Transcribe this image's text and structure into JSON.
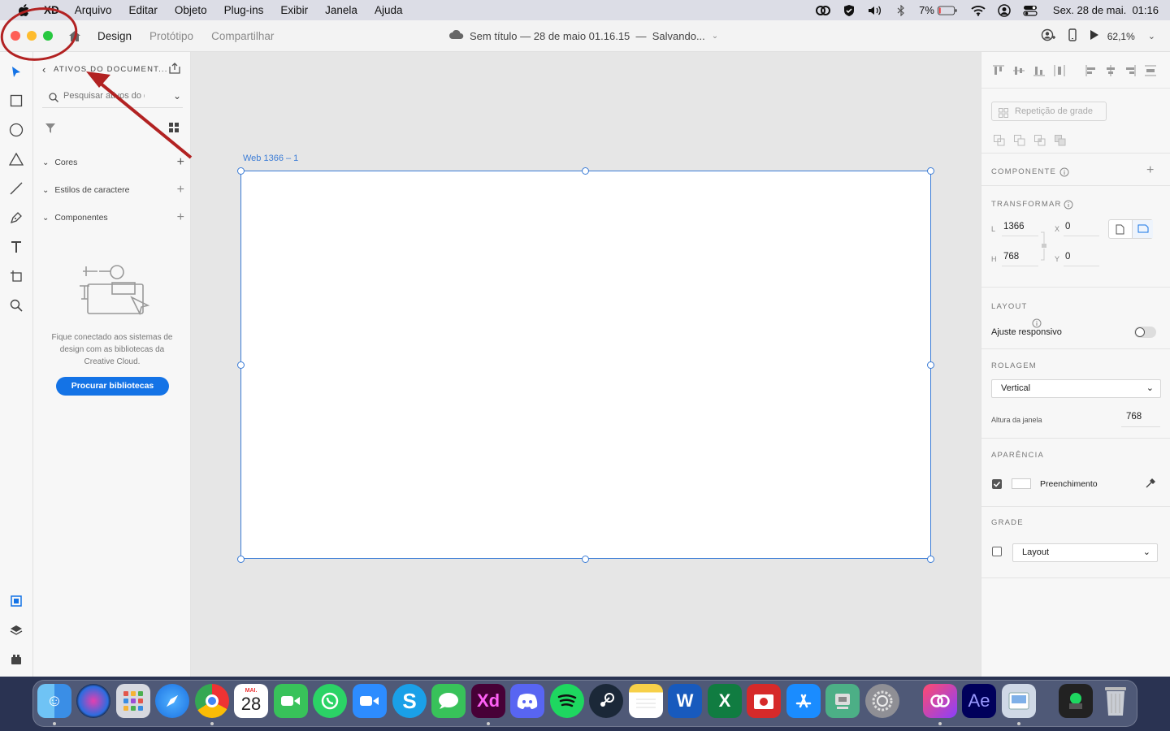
{
  "menubar": {
    "app_name": "XD",
    "items": [
      "Arquivo",
      "Editar",
      "Objeto",
      "Plug-ins",
      "Exibir",
      "Janela",
      "Ajuda"
    ],
    "battery": "7%",
    "datetime": "Sex. 28 de mai.  01:16"
  },
  "titlebar": {
    "tabs": [
      "Design",
      "Protótipo",
      "Compartilhar"
    ],
    "doc_title": "Sem título — 28 de maio 01.16.15  —  Salvando...",
    "zoom": "62,1%"
  },
  "left_panel": {
    "header": "ATIVOS DO DOCUMENT...",
    "search_placeholder": "Pesquisar ativos do documento",
    "sections": [
      "Cores",
      "Estilos de caractere",
      "Componentes"
    ],
    "empty_text": "Fique conectado aos sistemas de design com as bibliotecas da Creative Cloud.",
    "browse_button": "Procurar bibliotecas"
  },
  "canvas": {
    "artboard_name": "Web 1366 – 1"
  },
  "right_panel": {
    "repeat_grid": "Repetição de grade",
    "component_label": "COMPONENTE",
    "transform_label": "TRANSFORMAR",
    "w_label": "L",
    "w_value": "1366",
    "h_label": "H",
    "h_value": "768",
    "x_label": "X",
    "x_value": "0",
    "y_label": "Y",
    "y_value": "0",
    "layout_label": "LAYOUT",
    "responsive_label": "Ajuste responsivo",
    "scroll_label": "ROLAGEM",
    "scroll_value": "Vertical",
    "viewport_label": "Altura da janela",
    "viewport_value": "768",
    "appearance_label": "APARÊNCIA",
    "fill_label": "Preenchimento",
    "grid_label": "GRADE",
    "grid_value": "Layout"
  },
  "dock": {
    "calendar_month": "MAI.",
    "calendar_day": "28"
  },
  "colors": {
    "accent": "#1473e6",
    "annotation": "#b22222",
    "selection": "#3b7cd6"
  }
}
